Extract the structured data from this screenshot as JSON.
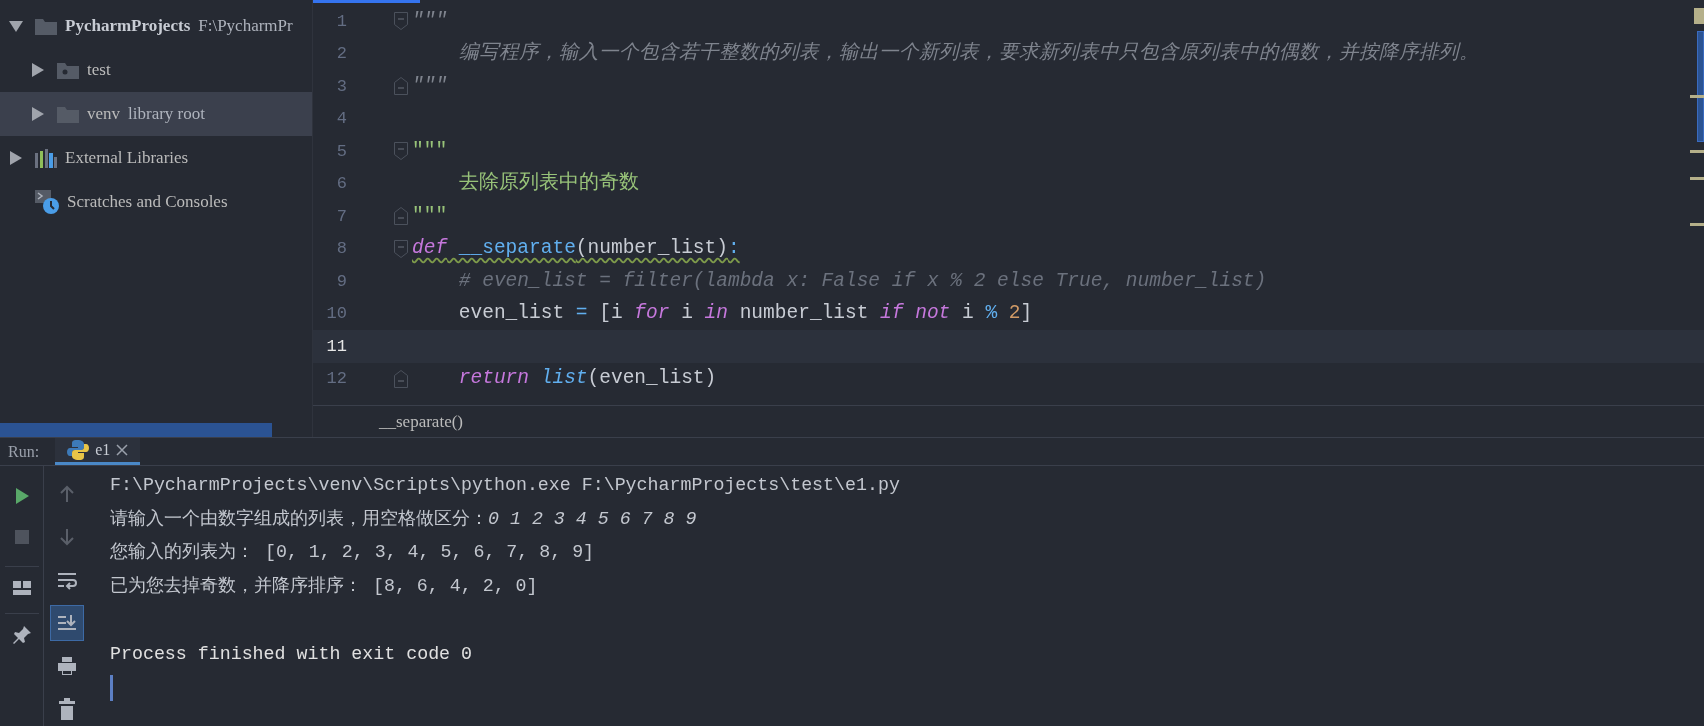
{
  "project_tree": {
    "items": [
      {
        "label": "PycharmProjects",
        "detail": "F:\\PycharmPr",
        "kind": "project",
        "expanded": true,
        "selected": false,
        "children": [
          {
            "label": "test",
            "kind": "source-folder",
            "expanded": false,
            "selected": false
          },
          {
            "label": "venv",
            "detail": "library root",
            "kind": "folder",
            "expanded": false,
            "selected": true
          }
        ]
      },
      {
        "label": "External Libraries",
        "kind": "libraries",
        "expanded": false,
        "selected": false
      },
      {
        "label": "Scratches and Consoles",
        "kind": "scratches",
        "selected": false
      }
    ]
  },
  "editor": {
    "lines": [
      {
        "number": "1",
        "fold_start": true,
        "current": false,
        "tokens": [
          {
            "text": "\"\"\"",
            "kind": "unused-string"
          }
        ]
      },
      {
        "number": "2",
        "current": false,
        "tokens": [
          {
            "text": "    编写程序，输入一个包含若干整数的列表，输出一个新列表，要求新列表中只包含原列表中的偶数，并按降序排列。",
            "kind": "unused-string"
          }
        ]
      },
      {
        "number": "3",
        "fold_end": true,
        "current": false,
        "tokens": [
          {
            "text": "\"\"\"",
            "kind": "unused-string"
          }
        ]
      },
      {
        "number": "4",
        "current": false
      },
      {
        "number": "5",
        "fold_start": true,
        "current": false,
        "tokens": [
          {
            "text": "\"\"\"",
            "kind": "string"
          }
        ]
      },
      {
        "number": "6",
        "current": false,
        "tokens": [
          {
            "text": "    去除原列表中的奇数",
            "kind": "string"
          }
        ]
      },
      {
        "number": "7",
        "fold_end": true,
        "current": false,
        "tokens": [
          {
            "text": "\"\"\"",
            "kind": "string"
          }
        ]
      },
      {
        "number": "8",
        "fold_start": true,
        "current": false,
        "tokens": [
          {
            "text": "def",
            "kind": "keyword",
            "warning": true
          },
          {
            "text": " __separate",
            "kind": "function",
            "warning": true
          },
          {
            "text": "(number_list)",
            "kind": "plain",
            "warning": true
          },
          {
            "text": ":",
            "kind": "operator",
            "warning": true
          }
        ]
      },
      {
        "number": "9",
        "current": false,
        "tokens": [
          {
            "text": "    # even_list = filter(lambda x: False if x % 2 else True, number_list)",
            "kind": "comment"
          }
        ]
      },
      {
        "number": "10",
        "current": false,
        "tokens": [
          {
            "text": "    even_list ",
            "kind": "plain"
          },
          {
            "text": "=",
            "kind": "operator"
          },
          {
            "text": " [i ",
            "kind": "plain"
          },
          {
            "text": "for",
            "kind": "keyword"
          },
          {
            "text": " i ",
            "kind": "plain"
          },
          {
            "text": "in",
            "kind": "keyword"
          },
          {
            "text": " number_list ",
            "kind": "plain"
          },
          {
            "text": "if not",
            "kind": "keyword"
          },
          {
            "text": " i ",
            "kind": "plain"
          },
          {
            "text": "% ",
            "kind": "operator"
          },
          {
            "text": "2",
            "kind": "number"
          },
          {
            "text": "]",
            "kind": "plain"
          }
        ]
      },
      {
        "number": "11",
        "current": true
      },
      {
        "number": "12",
        "fold_end": true,
        "current": false,
        "tokens": [
          {
            "text": "    return",
            "kind": "keyword"
          },
          {
            "text": " list",
            "kind": "builtin"
          },
          {
            "text": "(even_list)",
            "kind": "plain"
          }
        ]
      }
    ],
    "breadcrumb": "__separate()"
  },
  "run_panel": {
    "label": "Run:",
    "tabs": [
      {
        "label": "e1",
        "selected": true
      }
    ],
    "left_toolbar": [
      {
        "kind": "rerun",
        "disabled": false
      },
      {
        "kind": "stop",
        "disabled": true
      },
      {
        "kind": "layout",
        "disabled": false
      },
      {
        "kind": "pin",
        "disabled": false
      }
    ],
    "side_toolbar": [
      {
        "kind": "up",
        "disabled": true,
        "on": false
      },
      {
        "kind": "down",
        "disabled": true,
        "on": false
      },
      {
        "kind": "wrap",
        "disabled": false,
        "on": false
      },
      {
        "kind": "scroll-end",
        "disabled": false,
        "on": true
      },
      {
        "kind": "print",
        "disabled": false,
        "on": false
      },
      {
        "kind": "trash",
        "disabled": false,
        "on": false
      }
    ],
    "console": {
      "lines": [
        "F:\\PycharmProjects\\venv\\Scripts\\python.exe F:\\PycharmProjects\\test\\e1.py",
        "请输入一个由数字组成的列表，用空格做区分：*0 1 2 3 4 5 6 7 8 9*",
        "您输入的列表为： [0, 1, 2, 3, 4, 5, 6, 7, 8, 9]",
        "已为您去掉奇数，并降序排序： [8, 6, 4, 2, 0]"
      ],
      "exit_message": "Process finished with exit code 0"
    }
  }
}
